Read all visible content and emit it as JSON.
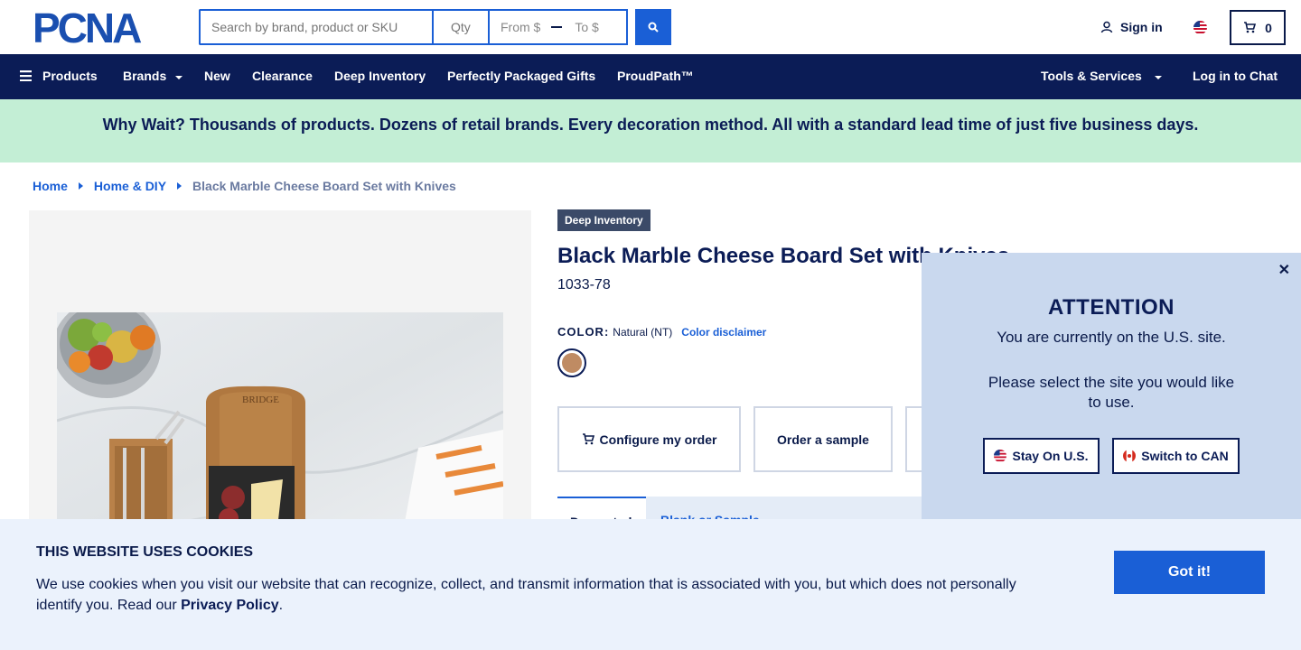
{
  "header": {
    "logo_text": "PCNA",
    "search_placeholder": "Search by brand, product or SKU",
    "qty_placeholder": "Qty",
    "price_from": "From $",
    "price_to": "To $",
    "signin_label": "Sign in",
    "cart_count": "0"
  },
  "nav": {
    "products": "Products",
    "brands": "Brands",
    "new": "New",
    "clearance": "Clearance",
    "deep_inventory": "Deep Inventory",
    "gifts": "Perfectly Packaged Gifts",
    "proudpath": "ProudPath™",
    "tools": "Tools & Services",
    "chat": "Log in to Chat"
  },
  "banner": {
    "text": "Why Wait? Thousands of products. Dozens of retail brands. Every decoration method. All with a standard lead time of just five business days."
  },
  "breadcrumb": {
    "home": "Home",
    "category": "Home & DIY",
    "current": "Black Marble Cheese Board Set with Knives"
  },
  "product": {
    "badge": "Deep Inventory",
    "title": "Black Marble Cheese Board Set with Knives",
    "sku": "1033-78",
    "color_label": "COLOR:",
    "color_value": "Natural (NT)",
    "color_disclaimer": "Color disclaimer",
    "swatch_color": "#bf8b63",
    "actions": {
      "configure": "Configure my order",
      "sample": "Order a sample"
    },
    "tabs": {
      "active": "Decorated",
      "other": "Blank or Sample"
    }
  },
  "attention": {
    "title": "ATTENTION",
    "message": "You are currently on the U.S. site.",
    "message2": "Please select the site you would like to use.",
    "stay": "Stay On U.S.",
    "switch": "Switch to CAN"
  },
  "cookie": {
    "title": "THIS WEBSITE USES COOKIES",
    "text": "We use cookies when you visit our website that can recognize, collect, and transmit information that is associated with you, but which does not personally identify you. Read our ",
    "link": "Privacy Policy",
    "end": ".",
    "button": "Got it!"
  },
  "colors": {
    "brand_blue": "#1a5fd6",
    "navy": "#0b1c56",
    "banner_green": "#c3eed5"
  }
}
